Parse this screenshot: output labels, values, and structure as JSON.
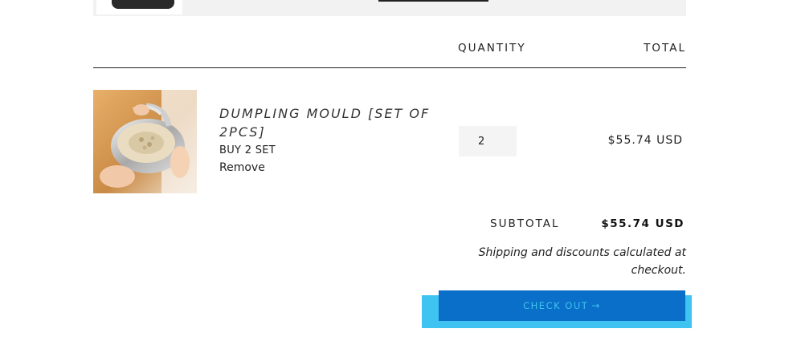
{
  "cart_table": {
    "quantity_header": "QUANTITY",
    "total_header": "TOTAL"
  },
  "line_item": {
    "name": "DUMPLING MOULD [SET OF 2PCS]",
    "variant": "BUY 2 SET",
    "remove_label": "Remove",
    "quantity": "2",
    "line_total": "$55.74 USD",
    "image_icon": "dumpling-mould-product-photo"
  },
  "summary": {
    "subtotal_label": "SUBTOTAL",
    "subtotal_value": "$55.74 USD",
    "shipping_note": "Shipping and discounts calculated at checkout."
  },
  "checkout": {
    "label": "CHECK OUT",
    "arrow": "→",
    "button_color": "#0a6fc8",
    "text_color": "#3fc3f0"
  }
}
